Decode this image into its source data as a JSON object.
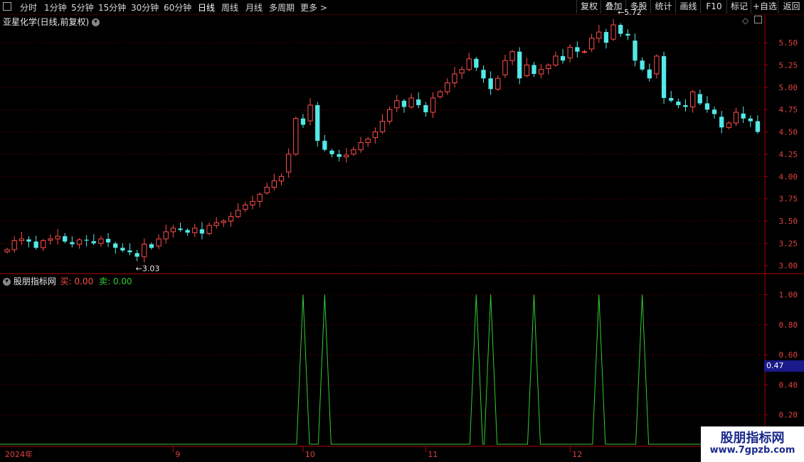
{
  "toolbar": {
    "periods": [
      "分时",
      "1分钟",
      "5分钟",
      "15分钟",
      "30分钟",
      "60分钟",
      "日线",
      "周线",
      "月线",
      "多周期",
      "更多 >"
    ],
    "actions": [
      "复权",
      "叠加",
      "多股",
      "统计",
      "画线",
      "F10",
      "标记",
      "+自选",
      "返回"
    ]
  },
  "chart_header": {
    "title": "亚星化学(日线,前复权)"
  },
  "indicator_header": {
    "name": "股朋指标网",
    "buy_label": "买: 0.00",
    "sell_label": "卖: 0.00"
  },
  "annotations": {
    "high": "5.72",
    "low": "3.03"
  },
  "current_value": "0.47",
  "watermark": {
    "line1": "股朋指标网",
    "line2": "www.7gpzb.com"
  },
  "colors": {
    "up": "#ff4d4d",
    "down": "#54e8e8",
    "grid": "#7a0000",
    "axis": "#b00000",
    "indicator": "#33cc33"
  },
  "chart_data": {
    "type": "candlestick",
    "y_ticks": [
      "5.50",
      "5.25",
      "5.00",
      "4.75",
      "4.50",
      "4.25",
      "4.00",
      "3.75",
      "3.50",
      "3.25",
      "3.00"
    ],
    "y_values": [
      5.5,
      5.25,
      5.0,
      4.75,
      4.5,
      4.25,
      4.0,
      3.75,
      3.5,
      3.25,
      3.0
    ],
    "x_labels": [
      "2024年",
      "9",
      "10",
      "11",
      "12"
    ],
    "x_label_index": [
      0,
      23,
      41,
      58,
      78
    ],
    "ylim": [
      2.95,
      5.78
    ],
    "closes": [
      3.18,
      3.28,
      3.3,
      3.27,
      3.2,
      3.28,
      3.3,
      3.33,
      3.27,
      3.24,
      3.29,
      3.28,
      3.25,
      3.3,
      3.26,
      3.2,
      3.17,
      3.15,
      3.1,
      3.24,
      3.2,
      3.3,
      3.38,
      3.42,
      3.4,
      3.37,
      3.42,
      3.36,
      3.45,
      3.48,
      3.5,
      3.55,
      3.62,
      3.68,
      3.72,
      3.8,
      3.88,
      3.95,
      4.0,
      4.25,
      4.65,
      4.58,
      4.8,
      4.4,
      4.3,
      4.25,
      4.22,
      4.24,
      4.3,
      4.38,
      4.42,
      4.5,
      4.62,
      4.75,
      4.85,
      4.78,
      4.88,
      4.8,
      4.72,
      4.88,
      4.95,
      5.05,
      5.15,
      5.2,
      5.32,
      5.22,
      5.1,
      4.98,
      5.1,
      5.3,
      5.4,
      5.1,
      5.25,
      5.15,
      5.2,
      5.25,
      5.35,
      5.3,
      5.45,
      5.4,
      5.4,
      5.55,
      5.62,
      5.5,
      5.7,
      5.6,
      5.58,
      5.3,
      5.2,
      5.1,
      5.35,
      4.88,
      4.85,
      4.8,
      4.78,
      4.95,
      4.82,
      4.75,
      4.7,
      4.55,
      4.6,
      4.72,
      4.65,
      4.62,
      4.5
    ],
    "indicator": {
      "name": "股朋指标网",
      "ylim": [
        0,
        1.05
      ],
      "y_ticks": [
        "1.00",
        "0.80",
        "0.60",
        "0.40",
        "0.20"
      ],
      "y_values": [
        1.0,
        0.8,
        0.6,
        0.4,
        0.2
      ],
      "peaks_index": [
        41,
        44,
        65,
        67,
        73,
        82,
        88
      ]
    }
  }
}
